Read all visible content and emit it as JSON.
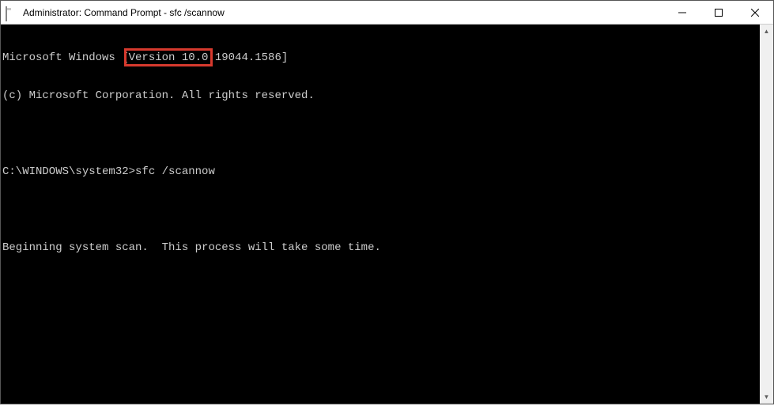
{
  "window": {
    "title": "Administrator: Command Prompt - sfc  /scannow"
  },
  "terminal": {
    "line1": "Microsoft Windows [Version 10.0.19044.1586]",
    "line2": "(c) Microsoft Corporation. All rights reserved.",
    "line3": "",
    "prompt": "C:\\WINDOWS\\system32>",
    "command": "sfc /scannow",
    "line5": "",
    "line6": "Beginning system scan.  This process will take some time."
  }
}
